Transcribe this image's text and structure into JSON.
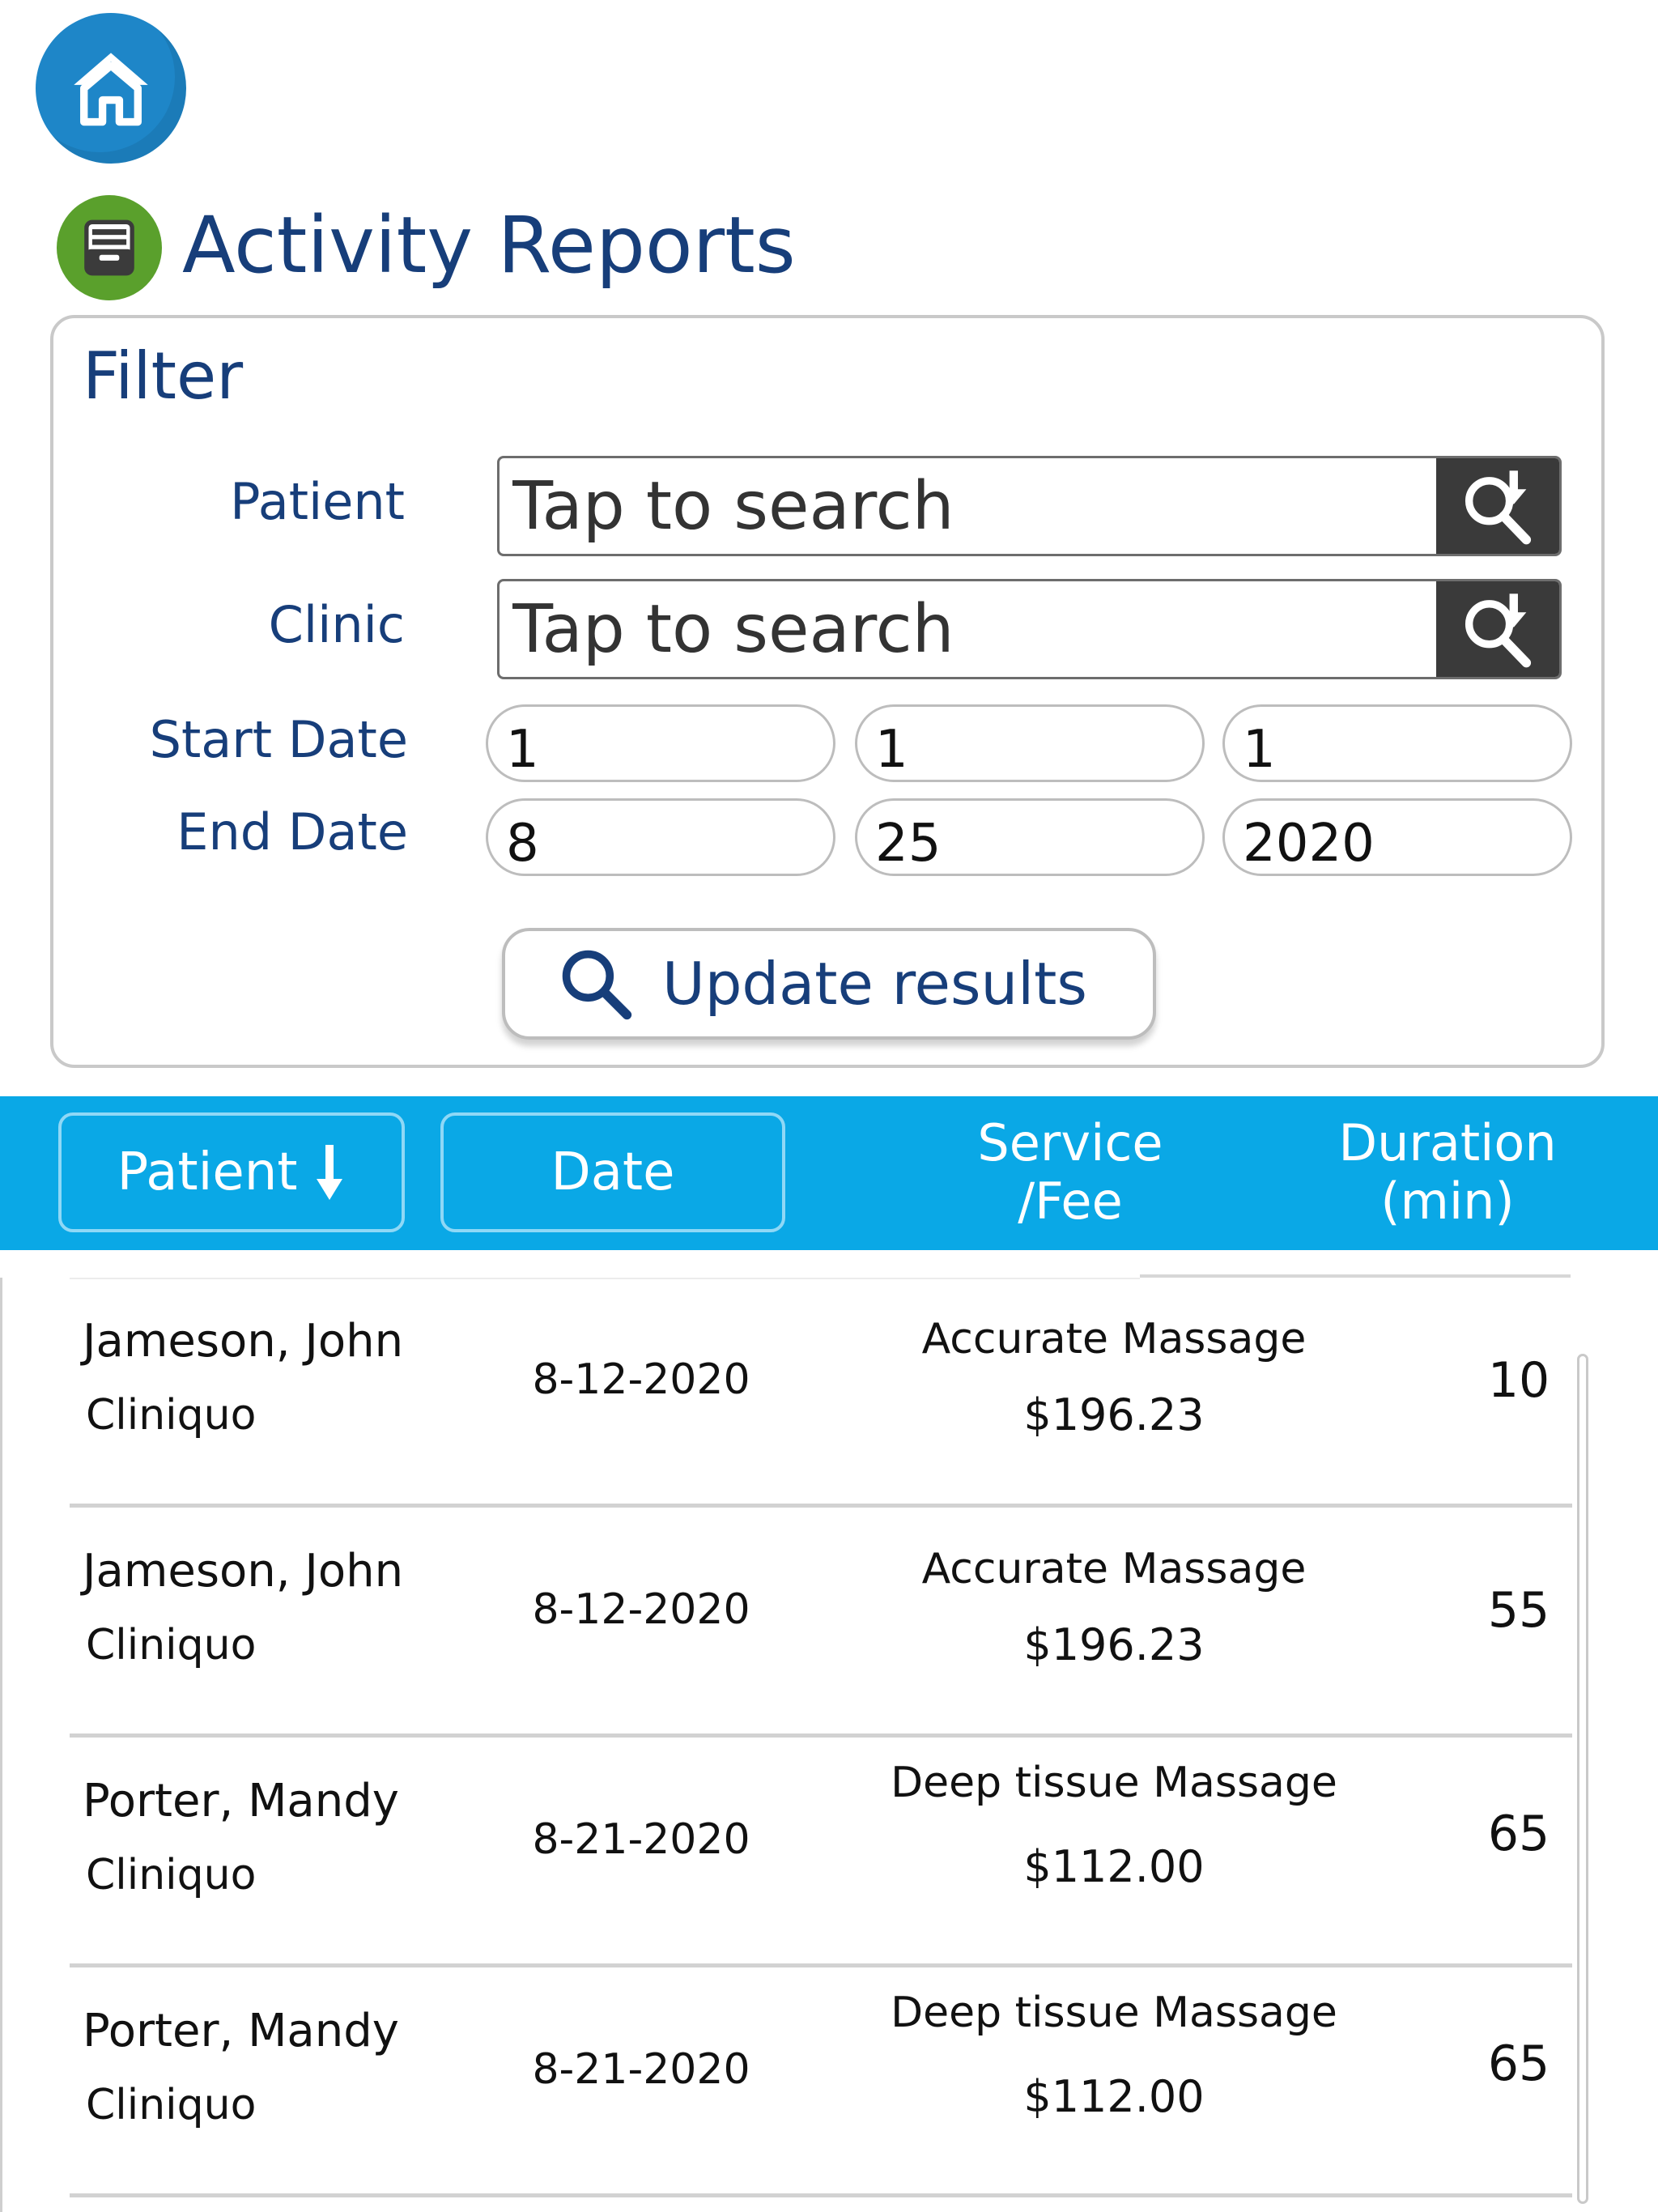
{
  "header": {
    "home_icon": "home-icon",
    "page_icon": "archive-box-icon",
    "title": "Activity Reports"
  },
  "filter": {
    "title": "Filter",
    "patient_label": "Patient",
    "patient_placeholder": "Tap to search",
    "clinic_label": "Clinic",
    "clinic_placeholder": "Tap to search",
    "search_icon": "search-download-icon",
    "start_date_label": "Start Date",
    "start_date": {
      "month": "1",
      "day": "1",
      "year": "1"
    },
    "end_date_label": "End Date",
    "end_date": {
      "month": "8",
      "day": "25",
      "year": "2020"
    },
    "update_label": "Update results",
    "update_icon": "magnifier-icon"
  },
  "table": {
    "columns": {
      "patient": "Patient",
      "patient_sort_icon": "arrow-down-icon",
      "date": "Date",
      "service_line1": "Service",
      "service_line2": "/Fee",
      "duration_line1": "Duration",
      "duration_line2": "(min)"
    },
    "rows": [
      {
        "name": "Jameson, John",
        "clinic": "Cliniquo",
        "date": "8-12-2020",
        "service": "Accurate Massage",
        "fee": "$196.23",
        "duration": "10"
      },
      {
        "name": "Jameson, John",
        "clinic": "Cliniquo",
        "date": "8-12-2020",
        "service": "Accurate Massage",
        "fee": "$196.23",
        "duration": "55"
      },
      {
        "name": "Porter, Mandy",
        "clinic": "Cliniquo",
        "date": "8-21-2020",
        "service": "Deep tissue Massage",
        "fee": "$112.00",
        "duration": "65"
      },
      {
        "name": "Porter, Mandy",
        "clinic": "Cliniquo",
        "date": "8-21-2020",
        "service": "Deep tissue Massage",
        "fee": "$112.00",
        "duration": "65"
      }
    ]
  },
  "colors": {
    "title_blue": "#173e7a",
    "home_blue": "#1e86c8",
    "header_bar": "#0aa8e6",
    "page_icon_green": "#5aa02c",
    "search_button": "#3a3a3a"
  }
}
